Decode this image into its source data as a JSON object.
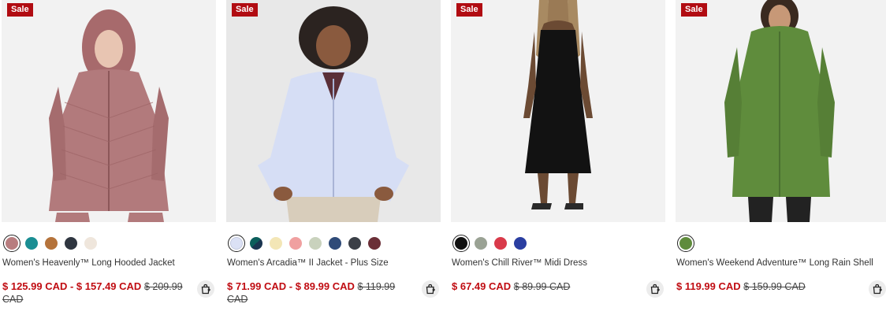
{
  "products": [
    {
      "badge": "Sale",
      "name": "Women's Heavenly™ Long Hooded Jacket",
      "price_range": "$ 125.99 CAD - $ 157.49 CAD",
      "original_price": "$ 209.99 CAD",
      "colors": [
        "#b87d7f",
        "#1a8e93",
        "#b5733b",
        "#2f3640",
        "#efe6dc"
      ],
      "image_icon": "womens-long-hooded-jacket-mauve"
    },
    {
      "badge": "Sale",
      "name": "Women's Arcadia™ II Jacket - Plus Size",
      "price_range": "$ 71.99 CAD - $ 89.99 CAD",
      "original_price": "$ 119.99 CAD",
      "colors": [
        "#dbe1f5",
        "split-teal",
        "#f3e6b6",
        "#f0a0a0",
        "#c9d2bd",
        "#2f4b78",
        "#3b3f47",
        "#6b2f37"
      ],
      "image_icon": "womens-arcadia-jacket-light-blue"
    },
    {
      "badge": "Sale",
      "name": "Women's Chill River™ Midi Dress",
      "price_range": "$ 67.49 CAD",
      "original_price": "$ 89.99 CAD",
      "colors": [
        "#111111",
        "#9aa294",
        "#d93a4a",
        "#2a3ea1"
      ],
      "image_icon": "womens-black-midi-dress"
    },
    {
      "badge": "Sale",
      "name": "Women's Weekend Adventure™ Long Rain Shell",
      "price_range": "$ 119.99 CAD",
      "original_price": "$ 159.99 CAD",
      "colors": [
        "#5f8c3c"
      ],
      "image_icon": "womens-long-rain-shell-green"
    }
  ],
  "icons": {
    "cart": "quick-add-bag-icon"
  }
}
